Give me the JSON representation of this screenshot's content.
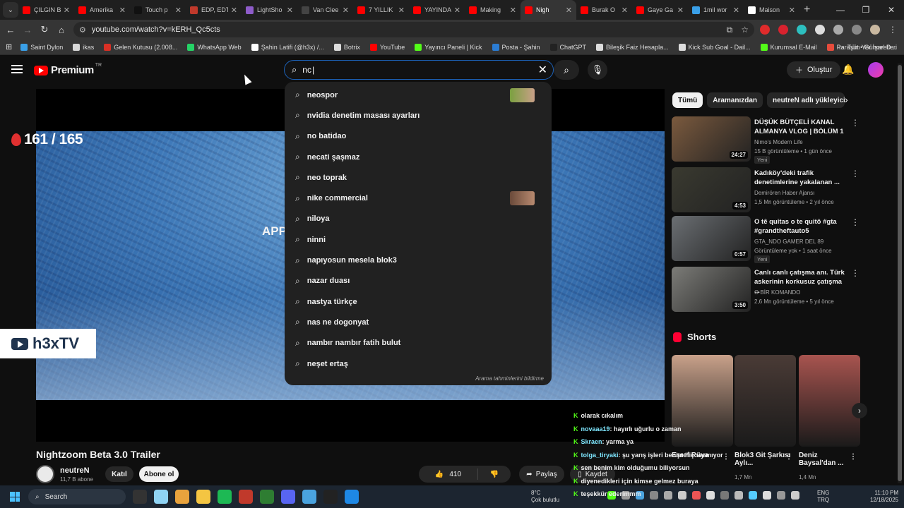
{
  "browser": {
    "tabs": [
      {
        "label": "ÇILGIN B",
        "color": "#ff0000"
      },
      {
        "label": "Amerika",
        "color": "#ff0000"
      },
      {
        "label": "Touch p",
        "color": "#111111"
      },
      {
        "label": "EDP, EDT",
        "color": "#c0392b"
      },
      {
        "label": "LightSho",
        "color": "#8e5cc9"
      },
      {
        "label": "Van Clee",
        "color": "#444444"
      },
      {
        "label": "7 YILLIK",
        "color": "#ff0000"
      },
      {
        "label": "YAYINDA",
        "color": "#ff0000"
      },
      {
        "label": "Making",
        "color": "#ff0000"
      },
      {
        "label": "Nigh",
        "color": "#ff0000"
      },
      {
        "label": "Burak O",
        "color": "#ff0000"
      },
      {
        "label": "Gaye Ga",
        "color": "#ff0000"
      },
      {
        "label": "1mil wor",
        "color": "#3aa0e8"
      },
      {
        "label": "Maison",
        "color": "#ffffff"
      }
    ],
    "active_tab": 9,
    "url": "youtube.com/watch?v=kERH_Qc5cts",
    "bookmarks": [
      {
        "label": "Saint Dylon",
        "color": "#3aa0e8"
      },
      {
        "label": "ikas",
        "color": "#d8d8d8"
      },
      {
        "label": "Gelen Kutusu (2.008...",
        "color": "#d93025"
      },
      {
        "label": "WhatsApp Web",
        "color": "#25d366"
      },
      {
        "label": "Şahin Latifi (@h3x) /...",
        "color": "#ffffff"
      },
      {
        "label": "Botrix",
        "color": "#dddddd"
      },
      {
        "label": "YouTube",
        "color": "#ff0000"
      },
      {
        "label": "Yayıncı Paneli | Kick",
        "color": "#53fc18"
      },
      {
        "label": "Posta - Şahin",
        "color": "#2b7cd3"
      },
      {
        "label": "ChatGPT",
        "color": "#222222"
      },
      {
        "label": "Bileşik Faiz Hesapla...",
        "color": "#dddddd"
      },
      {
        "label": "Kick Sub Goal - Dail...",
        "color": "#dddddd"
      },
      {
        "label": "Kurumsal E-Mail",
        "color": "#53fc18"
      },
      {
        "label": "Paraşüt • Güncel D...",
        "color": "#e74c3c"
      }
    ],
    "all_bookmarks": "Tüm Yer İşaretleri"
  },
  "youtube": {
    "logo_text": "Premium",
    "logo_sup": "TR",
    "search_value": "nc",
    "create_label": "Oluştur",
    "suggestions": [
      {
        "text": "neospor",
        "thumb": true
      },
      {
        "text": "nvidia denetim masası ayarları",
        "thumb": false
      },
      {
        "text": "no batidao",
        "thumb": false
      },
      {
        "text": "necati şaşmaz",
        "thumb": false
      },
      {
        "text": "neo toprak",
        "thumb": false
      },
      {
        "text": "nike commercial",
        "thumb": true
      },
      {
        "text": "niloya",
        "thumb": false
      },
      {
        "text": "ninni",
        "thumb": false
      },
      {
        "text": "napıyosun mesela blok3",
        "thumb": false
      },
      {
        "text": "nazar duası",
        "thumb": false
      },
      {
        "text": "nastya türkçe",
        "thumb": false
      },
      {
        "text": "nas ne dogonyat",
        "thumb": false
      },
      {
        "text": "nambır nambır fatih bulut",
        "thumb": false
      },
      {
        "text": "neşet ertaş",
        "thumb": false
      }
    ],
    "suggestions_footer": "Arama tahminlerini bildirme",
    "video": {
      "counter": "161 / 165",
      "overlay_text": "APPL",
      "watermark": "h3xTV",
      "title": "Nightzoom Beta 3.0 Trailer",
      "channel": "neutreN",
      "subs": "11,7 B abone",
      "join": "Katıl",
      "subscribe": "Abone ol",
      "likes": "410",
      "share": "Paylaş",
      "save": "Kaydet"
    },
    "chat": [
      {
        "user": "",
        "msg": "olarak cıkalım"
      },
      {
        "user": "novaaa19",
        "msg": ": hayırlı uğurlu o zaman"
      },
      {
        "user": "Skraen",
        "msg": ": yarma ya"
      },
      {
        "user": "tolga_tiryaki",
        "msg": ": şu yarış işleri benim hiç sarmıyor"
      },
      {
        "user": "",
        "msg": "sen benim kim olduğumu biliyorsun"
      },
      {
        "user": "",
        "msg": "diyenedikleri için kimse gelmez buraya"
      },
      {
        "user": "",
        "msg": "teşekkür ederimmm"
      }
    ],
    "chips": [
      "Tümü",
      "Aramanızdan",
      "neutreN adlı yükleyiciden"
    ],
    "recommendations": [
      {
        "title": "DÜŞÜK BÜTÇELİ KANAL ALMANYA VLOG | BÖLÜM 1",
        "channel": "Nimo's Modern Life",
        "meta": "15 B görüntüleme • 1 gün önce",
        "badge": "Yeni",
        "duration": "24:27",
        "color": "#7b5a3e"
      },
      {
        "title": "Kadıköy'deki trafik denetimlerine yakalanan ...",
        "channel": "Demirören Haber Ajansı",
        "meta": "1,5 Mn görüntüleme • 2 yıl önce",
        "badge": "",
        "duration": "4:53",
        "color": "#3a3a30"
      },
      {
        "title": "O tê quitas o te quitô #gta #grandtheftauto5",
        "channel": "GTA_NDO GAMER DEL 89",
        "meta": "Görüntüleme yok • 1 saat önce",
        "badge": "Yeni",
        "duration": "0:57",
        "color": "#6b6f73"
      },
      {
        "title": "Canlı canlı çatışma anı. Türk askerinin korkusuz çatışma ...",
        "channel": "O BİR KOMANDO",
        "meta": "2,6 Mn görüntüleme • 5 yıl önce",
        "badge": "",
        "duration": "3:50",
        "color": "#7c7c78"
      }
    ],
    "shorts_title": "Shorts",
    "shorts": [
      {
        "title": "Eşref Rüya",
        "meta": "",
        "color": "#c9a18a"
      },
      {
        "title": "Blok3 Git Şarkısı Aylı...",
        "meta": "1,7 Mn",
        "color": "#4a3b36"
      },
      {
        "title": "Deniz Baysal'dan ...",
        "meta": "1,4 Mn",
        "color": "#a8544f"
      }
    ]
  },
  "taskbar": {
    "search": "Search",
    "weather_temp": "8°C",
    "weather_desc": "Çok bulutlu",
    "lang": "ENG",
    "lang2": "TRQ",
    "time": "11:10 PM",
    "date": "12/18/2025"
  }
}
